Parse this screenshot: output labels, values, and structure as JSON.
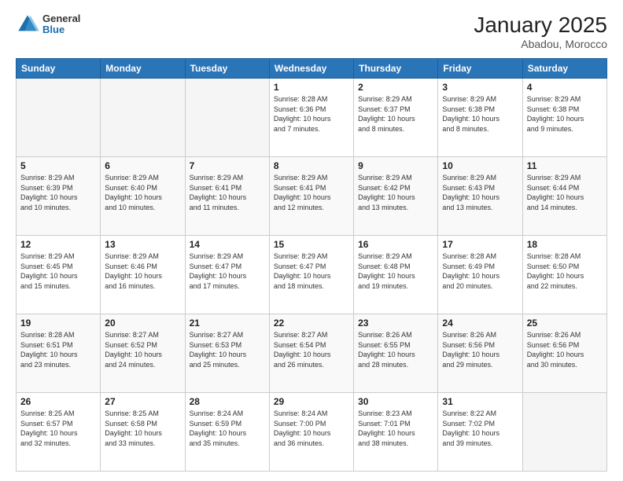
{
  "header": {
    "logo_general": "General",
    "logo_blue": "Blue",
    "month": "January 2025",
    "location": "Abadou, Morocco"
  },
  "weekdays": [
    "Sunday",
    "Monday",
    "Tuesday",
    "Wednesday",
    "Thursday",
    "Friday",
    "Saturday"
  ],
  "weeks": [
    [
      {
        "day": "",
        "detail": ""
      },
      {
        "day": "",
        "detail": ""
      },
      {
        "day": "",
        "detail": ""
      },
      {
        "day": "1",
        "detail": "Sunrise: 8:28 AM\nSunset: 6:36 PM\nDaylight: 10 hours\nand 7 minutes."
      },
      {
        "day": "2",
        "detail": "Sunrise: 8:29 AM\nSunset: 6:37 PM\nDaylight: 10 hours\nand 8 minutes."
      },
      {
        "day": "3",
        "detail": "Sunrise: 8:29 AM\nSunset: 6:38 PM\nDaylight: 10 hours\nand 8 minutes."
      },
      {
        "day": "4",
        "detail": "Sunrise: 8:29 AM\nSunset: 6:38 PM\nDaylight: 10 hours\nand 9 minutes."
      }
    ],
    [
      {
        "day": "5",
        "detail": "Sunrise: 8:29 AM\nSunset: 6:39 PM\nDaylight: 10 hours\nand 10 minutes."
      },
      {
        "day": "6",
        "detail": "Sunrise: 8:29 AM\nSunset: 6:40 PM\nDaylight: 10 hours\nand 10 minutes."
      },
      {
        "day": "7",
        "detail": "Sunrise: 8:29 AM\nSunset: 6:41 PM\nDaylight: 10 hours\nand 11 minutes."
      },
      {
        "day": "8",
        "detail": "Sunrise: 8:29 AM\nSunset: 6:41 PM\nDaylight: 10 hours\nand 12 minutes."
      },
      {
        "day": "9",
        "detail": "Sunrise: 8:29 AM\nSunset: 6:42 PM\nDaylight: 10 hours\nand 13 minutes."
      },
      {
        "day": "10",
        "detail": "Sunrise: 8:29 AM\nSunset: 6:43 PM\nDaylight: 10 hours\nand 13 minutes."
      },
      {
        "day": "11",
        "detail": "Sunrise: 8:29 AM\nSunset: 6:44 PM\nDaylight: 10 hours\nand 14 minutes."
      }
    ],
    [
      {
        "day": "12",
        "detail": "Sunrise: 8:29 AM\nSunset: 6:45 PM\nDaylight: 10 hours\nand 15 minutes."
      },
      {
        "day": "13",
        "detail": "Sunrise: 8:29 AM\nSunset: 6:46 PM\nDaylight: 10 hours\nand 16 minutes."
      },
      {
        "day": "14",
        "detail": "Sunrise: 8:29 AM\nSunset: 6:47 PM\nDaylight: 10 hours\nand 17 minutes."
      },
      {
        "day": "15",
        "detail": "Sunrise: 8:29 AM\nSunset: 6:47 PM\nDaylight: 10 hours\nand 18 minutes."
      },
      {
        "day": "16",
        "detail": "Sunrise: 8:29 AM\nSunset: 6:48 PM\nDaylight: 10 hours\nand 19 minutes."
      },
      {
        "day": "17",
        "detail": "Sunrise: 8:28 AM\nSunset: 6:49 PM\nDaylight: 10 hours\nand 20 minutes."
      },
      {
        "day": "18",
        "detail": "Sunrise: 8:28 AM\nSunset: 6:50 PM\nDaylight: 10 hours\nand 22 minutes."
      }
    ],
    [
      {
        "day": "19",
        "detail": "Sunrise: 8:28 AM\nSunset: 6:51 PM\nDaylight: 10 hours\nand 23 minutes."
      },
      {
        "day": "20",
        "detail": "Sunrise: 8:27 AM\nSunset: 6:52 PM\nDaylight: 10 hours\nand 24 minutes."
      },
      {
        "day": "21",
        "detail": "Sunrise: 8:27 AM\nSunset: 6:53 PM\nDaylight: 10 hours\nand 25 minutes."
      },
      {
        "day": "22",
        "detail": "Sunrise: 8:27 AM\nSunset: 6:54 PM\nDaylight: 10 hours\nand 26 minutes."
      },
      {
        "day": "23",
        "detail": "Sunrise: 8:26 AM\nSunset: 6:55 PM\nDaylight: 10 hours\nand 28 minutes."
      },
      {
        "day": "24",
        "detail": "Sunrise: 8:26 AM\nSunset: 6:56 PM\nDaylight: 10 hours\nand 29 minutes."
      },
      {
        "day": "25",
        "detail": "Sunrise: 8:26 AM\nSunset: 6:56 PM\nDaylight: 10 hours\nand 30 minutes."
      }
    ],
    [
      {
        "day": "26",
        "detail": "Sunrise: 8:25 AM\nSunset: 6:57 PM\nDaylight: 10 hours\nand 32 minutes."
      },
      {
        "day": "27",
        "detail": "Sunrise: 8:25 AM\nSunset: 6:58 PM\nDaylight: 10 hours\nand 33 minutes."
      },
      {
        "day": "28",
        "detail": "Sunrise: 8:24 AM\nSunset: 6:59 PM\nDaylight: 10 hours\nand 35 minutes."
      },
      {
        "day": "29",
        "detail": "Sunrise: 8:24 AM\nSunset: 7:00 PM\nDaylight: 10 hours\nand 36 minutes."
      },
      {
        "day": "30",
        "detail": "Sunrise: 8:23 AM\nSunset: 7:01 PM\nDaylight: 10 hours\nand 38 minutes."
      },
      {
        "day": "31",
        "detail": "Sunrise: 8:22 AM\nSunset: 7:02 PM\nDaylight: 10 hours\nand 39 minutes."
      },
      {
        "day": "",
        "detail": ""
      }
    ]
  ]
}
